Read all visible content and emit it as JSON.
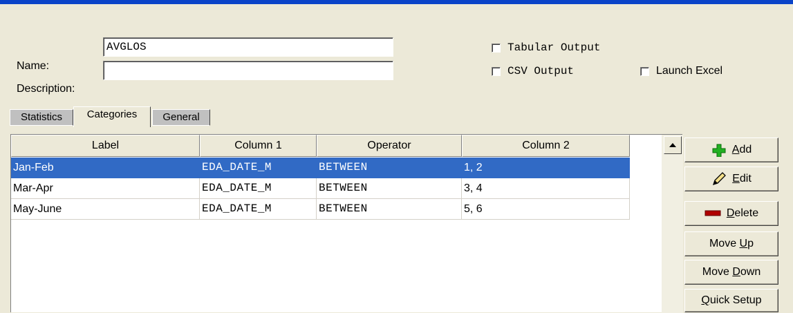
{
  "form": {
    "name_label": "Name:",
    "name_value": "AVGLOS",
    "description_label": "Description:",
    "description_value": ""
  },
  "options": {
    "tabular_output": {
      "label": "Tabular Output",
      "checked": false
    },
    "csv_output": {
      "label": "CSV Output",
      "checked": false
    },
    "launch_excel": {
      "label": "Launch Excel",
      "checked": false
    }
  },
  "tabs": [
    {
      "label": "Statistics",
      "active": false
    },
    {
      "label": "Categories",
      "active": true
    },
    {
      "label": "General",
      "active": false
    }
  ],
  "grid": {
    "columns": [
      "Label",
      "Column 1",
      "Operator",
      "Column 2"
    ],
    "rows": [
      {
        "label": "Jan-Feb",
        "column1": "EDA_DATE_M",
        "operator": "BETWEEN",
        "column2": "1, 2",
        "selected": true
      },
      {
        "label": "Mar-Apr",
        "column1": "EDA_DATE_M",
        "operator": "BETWEEN",
        "column2": "3, 4",
        "selected": false
      },
      {
        "label": "May-June",
        "column1": "EDA_DATE_M",
        "operator": "BETWEEN",
        "column2": "5, 6",
        "selected": false
      }
    ]
  },
  "buttons": {
    "add": {
      "pre": "",
      "hot": "A",
      "post": "dd",
      "icon": "plus-icon"
    },
    "edit": {
      "pre": "",
      "hot": "E",
      "post": "dit",
      "icon": "pencil-icon"
    },
    "delete": {
      "pre": "",
      "hot": "D",
      "post": "elete",
      "icon": "minus-icon"
    },
    "move_up": {
      "pre": "Move ",
      "hot": "U",
      "post": "p"
    },
    "move_down": {
      "pre": "Move ",
      "hot": "D",
      "post": "own"
    },
    "quick_setup": {
      "pre": "",
      "hot": "Q",
      "post": "uick Setup"
    }
  },
  "colors": {
    "title_bar": "#0a43c8",
    "selection": "#316ac5",
    "add_icon": "#22b022",
    "delete_icon": "#b00000"
  }
}
